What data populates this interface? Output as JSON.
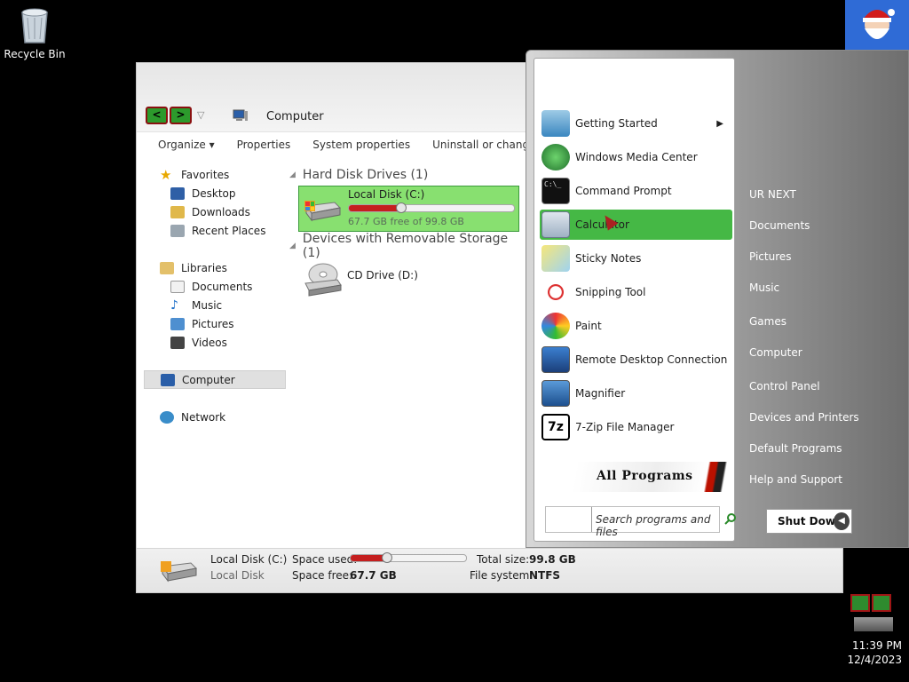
{
  "desktop": {
    "recycle_bin": "Recycle Bin"
  },
  "explorer": {
    "address": "Computer",
    "nav_back": "<",
    "nav_forward": ">",
    "toolbar": [
      "Organize ▾",
      "Properties",
      "System properties",
      "Uninstall or change a"
    ],
    "nav": {
      "favorites": "Favorites",
      "favorites_items": [
        "Desktop",
        "Downloads",
        "Recent Places"
      ],
      "libraries": "Libraries",
      "libraries_items": [
        "Documents",
        "Music",
        "Pictures",
        "Videos"
      ],
      "computer": "Computer",
      "network": "Network"
    },
    "groups": {
      "hdd_title": "Hard Disk Drives (1)",
      "removable_title": "Devices with Removable Storage (1)"
    },
    "drives": {
      "c_name": "Local Disk (C:)",
      "c_free": "67.7 GB free of 99.8 GB",
      "c_used_fraction": 0.32,
      "d_name": "CD Drive (D:)"
    },
    "status": {
      "name": "Local Disk (C:)",
      "type": "Local Disk",
      "space_used_label": "Space used:",
      "space_free_label": "Space free:",
      "space_free": "67.7 GB",
      "total_size_label": "Total size:",
      "total_size": "99.8 GB",
      "fs_label": "File system:",
      "fs": "NTFS"
    }
  },
  "start_menu": {
    "programs": [
      "Getting Started",
      "Windows Media Center",
      "Command Prompt",
      "Calculator",
      "Sticky Notes",
      "Snipping Tool",
      "Paint",
      "Remote Desktop Connection",
      "Magnifier",
      "7-Zip File Manager"
    ],
    "all_programs": "All Programs",
    "search_placeholder": "Search programs and files",
    "right": [
      "UR NEXT",
      "Documents",
      "Pictures",
      "Music",
      "Games",
      "Computer",
      "Control Panel",
      "Devices and Printers",
      "Default Programs",
      "Help and Support"
    ],
    "shutdown": "Shut Down"
  },
  "tray": {
    "time": "11:39 PM",
    "date": "12/4/2023"
  }
}
